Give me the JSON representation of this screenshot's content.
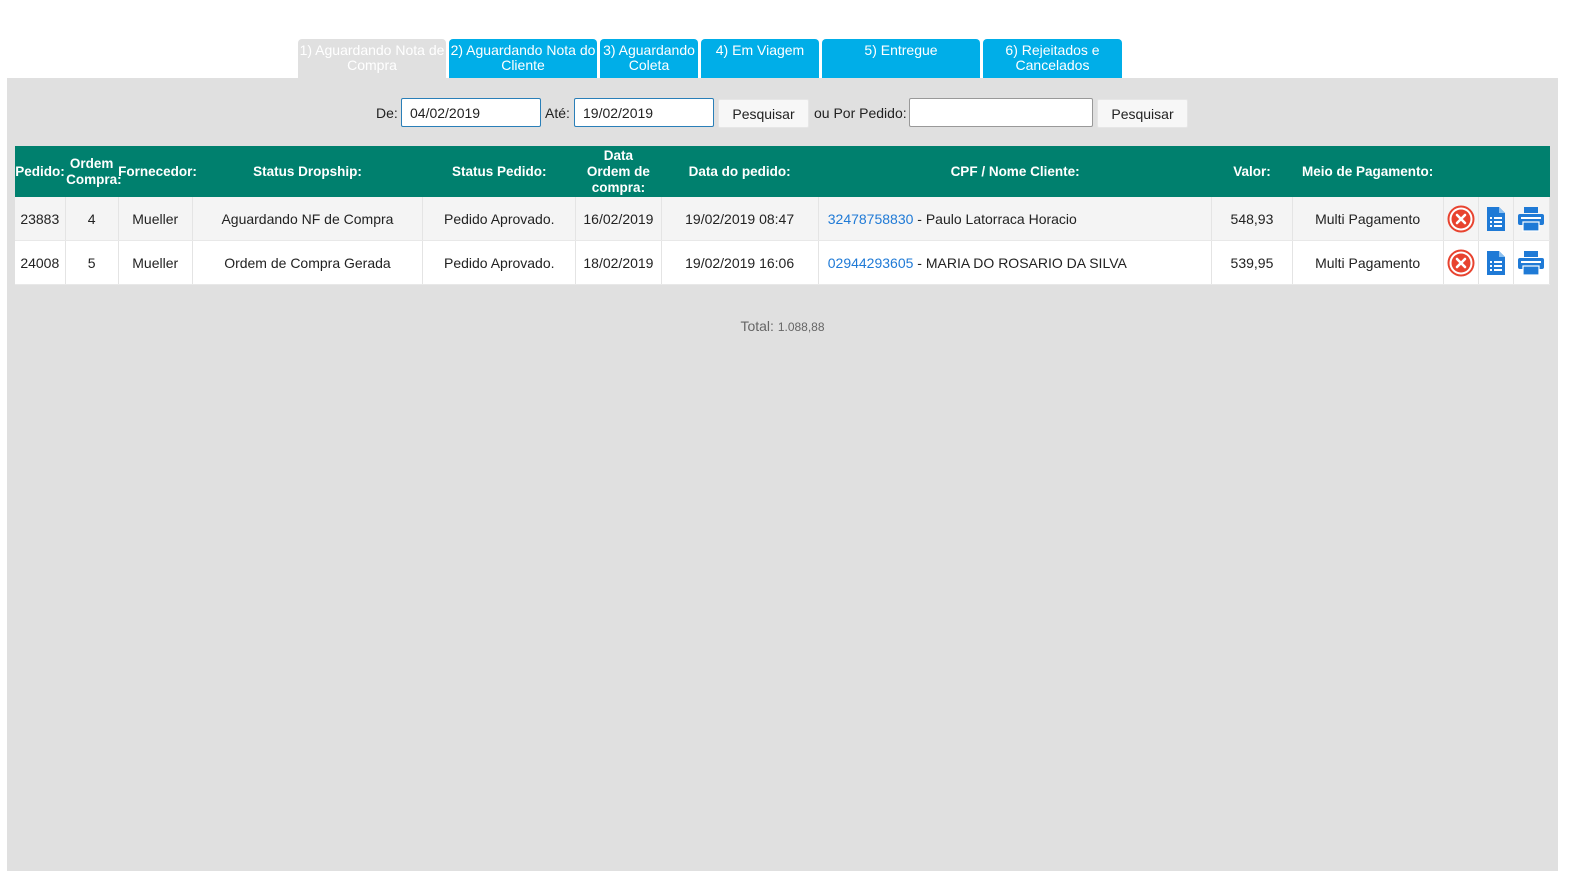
{
  "tabs": [
    {
      "label": "1) Aguardando Nota de Compra",
      "active": true
    },
    {
      "label": "2) Aguardando Nota do Cliente",
      "active": false
    },
    {
      "label": "3) Aguardando Coleta",
      "active": false
    },
    {
      "label": "4) Em Viagem",
      "active": false
    },
    {
      "label": "5) Entregue",
      "active": false
    },
    {
      "label": "6) Rejeitados e Cancelados",
      "active": false
    }
  ],
  "filters": {
    "de_label": "De:",
    "de_value": "04/02/2019",
    "ate_label": "Até:",
    "ate_value": "19/02/2019",
    "search_label": "Pesquisar",
    "pedido_label": "ou Por Pedido:",
    "pedido_value": "",
    "search2_label": "Pesquisar"
  },
  "table": {
    "headers": {
      "pedido": "Pedido:",
      "ordem": "Ordem Compra:",
      "fornecedor": "Fornecedor:",
      "status_dropship": "Status Dropship:",
      "status_pedido": "Status Pedido:",
      "data_ordem": "Data Ordem de compra:",
      "data_pedido": "Data do pedido:",
      "cliente": "CPF / Nome Cliente:",
      "valor": "Valor:",
      "pagamento": "Meio de Pagamento:"
    },
    "rows": [
      {
        "pedido": "23883",
        "ordem": "4",
        "fornecedor": "Mueller",
        "status_dropship": "Aguardando NF de Compra",
        "status_pedido": "Pedido Aprovado.",
        "data_ordem": "16/02/2019",
        "data_pedido": "19/02/2019 08:47",
        "cpf": "32478758830",
        "nome": " - Paulo Latorraca Horacio",
        "valor": "548,93",
        "pagamento": "Multi Pagamento"
      },
      {
        "pedido": "24008",
        "ordem": "5",
        "fornecedor": "Mueller",
        "status_dropship": "Ordem de Compra Gerada",
        "status_pedido": "Pedido Aprovado.",
        "data_ordem": "18/02/2019",
        "data_pedido": "19/02/2019 16:06",
        "cpf": "02944293605",
        "nome": " - MARIA DO ROSARIO DA SILVA",
        "valor": "539,95",
        "pagamento": "Multi Pagamento"
      }
    ]
  },
  "total": {
    "label": "Total:",
    "value": "1.088,88"
  },
  "icons": {
    "cancel": "cancel-circle-icon",
    "details": "document-list-icon",
    "print": "printer-icon"
  },
  "colors": {
    "tab": "#00aee8",
    "header": "#00806e",
    "link": "#1f7ad6",
    "cancel": "#e8432f",
    "action": "#1f7ad6"
  }
}
